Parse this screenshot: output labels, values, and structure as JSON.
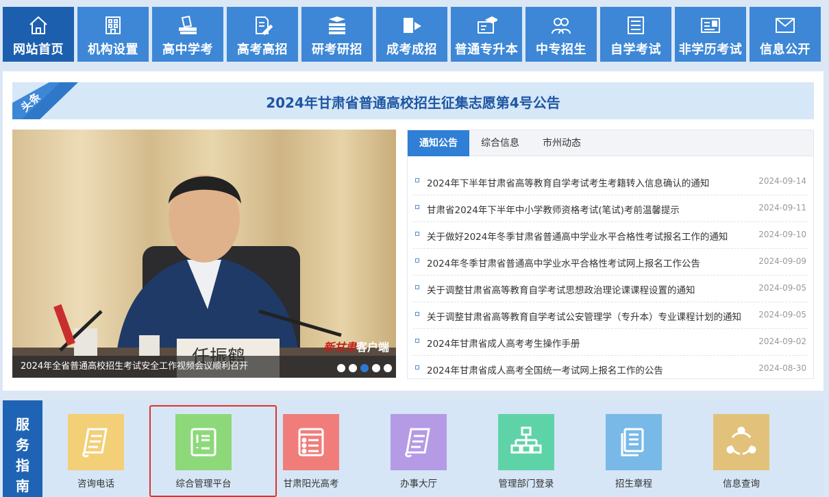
{
  "nav": {
    "items": [
      {
        "label": "网站首页",
        "icon": "home-icon"
      },
      {
        "label": "机构设置",
        "icon": "building-icon"
      },
      {
        "label": "高中学考",
        "icon": "books-icon"
      },
      {
        "label": "高考高招",
        "icon": "document-pen-icon"
      },
      {
        "label": "研考研招",
        "icon": "book-stack-icon"
      },
      {
        "label": "成考成招",
        "icon": "certificate-icon"
      },
      {
        "label": "普通专升本",
        "icon": "graduation-cap-icon"
      },
      {
        "label": "中专招生",
        "icon": "users-icon"
      },
      {
        "label": "自学考试",
        "icon": "list-icon"
      },
      {
        "label": "非学历考试",
        "icon": "id-card-icon"
      },
      {
        "label": "信息公开",
        "icon": "mail-icon"
      }
    ]
  },
  "headline": {
    "tag": "头条",
    "title": "2024年甘肃省普通高校招生征集志愿第4号公告"
  },
  "slider": {
    "caption": "2024年全省普通高校招生考试安全工作视频会议顺利召开",
    "watermark_brand": "新甘肃",
    "watermark_suffix": "客户端",
    "nameplate": "任振鹤",
    "active_dot": 3
  },
  "news": {
    "tabs": [
      "通知公告",
      "综合信息",
      "市州动态"
    ],
    "items": [
      {
        "title": "2024年下半年甘肃省高等教育自学考试考生考籍转入信息确认的通知",
        "date": "2024-09-14"
      },
      {
        "title": "甘肃省2024年下半年中小学教师资格考试(笔试)考前温馨提示",
        "date": "2024-09-11"
      },
      {
        "title": "关于做好2024年冬季甘肃省普通高中学业水平合格性考试报名工作的通知",
        "date": "2024-09-10"
      },
      {
        "title": "2024年冬季甘肃省普通高中学业水平合格性考试网上报名工作公告",
        "date": "2024-09-09"
      },
      {
        "title": "关于调整甘肃省高等教育自学考试思想政治理论课课程设置的通知",
        "date": "2024-09-05"
      },
      {
        "title": "关于调整甘肃省高等教育自学考试公安管理学（专升本）专业课程计划的通知",
        "date": "2024-09-05"
      },
      {
        "title": "2024年甘肃省成人高考考生操作手册",
        "date": "2024-09-02"
      },
      {
        "title": "2024年甘肃省成人高考全国统一考试网上报名工作的公告",
        "date": "2024-08-30"
      }
    ]
  },
  "services": {
    "label": "服务指南",
    "label_chars": [
      "服",
      "务",
      "指",
      "南"
    ],
    "items": [
      {
        "name": "咨询电话",
        "icon": "scroll-icon",
        "color": "#f3cf77"
      },
      {
        "name": "综合管理平台",
        "icon": "checklist-icon",
        "color": "#8dd97a"
      },
      {
        "name": "甘肃阳光高考",
        "icon": "list-doc-icon",
        "color": "#f07d7a"
      },
      {
        "name": "办事大厅",
        "icon": "scroll-icon",
        "color": "#b59ae6"
      },
      {
        "name": "管理部门登录",
        "icon": "org-chart-icon",
        "color": "#5fd3a8"
      },
      {
        "name": "招生章程",
        "icon": "documents-icon",
        "color": "#79b9e8"
      },
      {
        "name": "信息查询",
        "icon": "share-circle-icon",
        "color": "#e2c27a"
      }
    ]
  },
  "colors": {
    "nav": "#3d87d6",
    "nav_active": "#1c5fae",
    "headline_text": "#1d56a2",
    "highlight_border": "#e0302a"
  }
}
